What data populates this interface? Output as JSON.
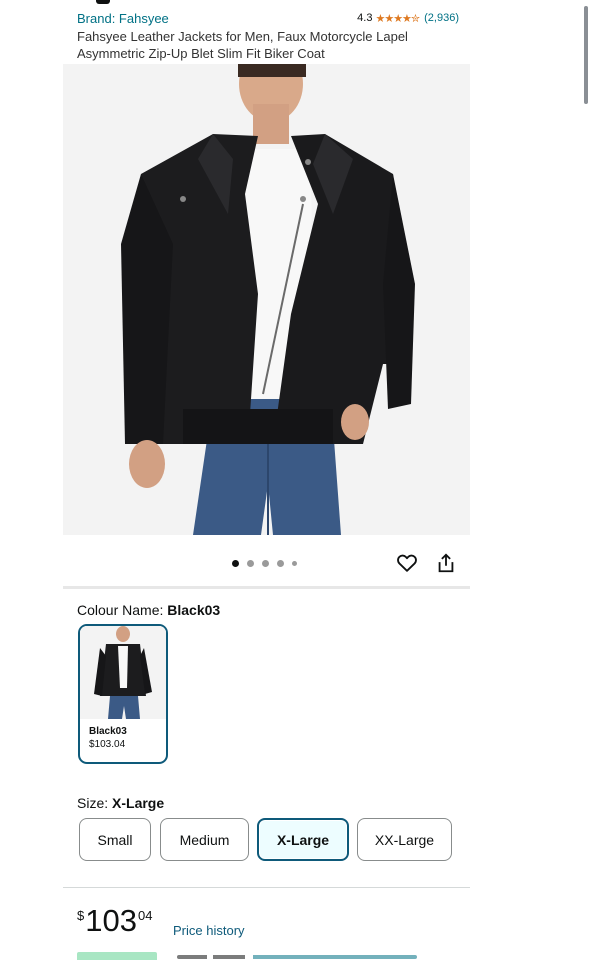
{
  "header": {
    "brand": "Brand: Fahsyee",
    "rating_value": "4.3",
    "stars": "★★★★✮",
    "rating_count": "(2,936)",
    "title": "Fahsyee Leather Jackets for Men, Faux Motorcycle Lapel Asymmetric Zip-Up Blet Slim Fit Biker Coat"
  },
  "gallery": {
    "image_count": 5,
    "active_index": 0
  },
  "actions": {
    "wishlist_icon": "heart-icon",
    "share_icon": "share-icon"
  },
  "colour": {
    "label": "Colour Name: ",
    "selected": "Black03",
    "options": [
      {
        "name": "Black03",
        "price": "$103.04"
      }
    ]
  },
  "size": {
    "label": "Size: ",
    "selected": "X-Large",
    "options": [
      "Small",
      "Medium",
      "X-Large",
      "XX-Large"
    ]
  },
  "price": {
    "symbol": "$",
    "whole": "103",
    "fraction": "04",
    "history_link": "Price history"
  },
  "colors": {
    "link": "#007185",
    "selected_border": "#0e5a7a",
    "star": "#de7921",
    "selected_fill": "#edfdff"
  }
}
